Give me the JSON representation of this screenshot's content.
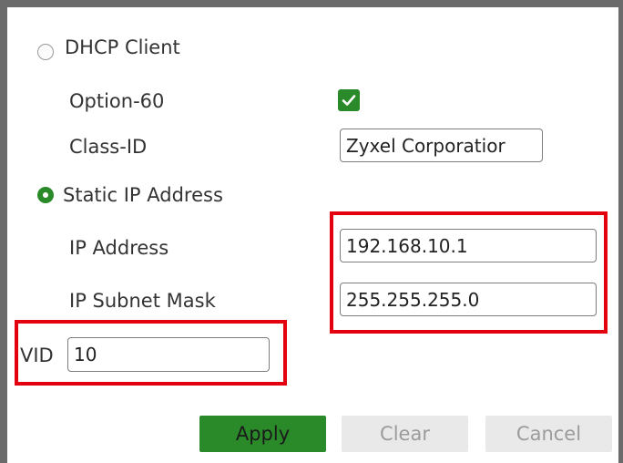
{
  "dhcp": {
    "label": "DHCP Client",
    "selected": false,
    "option60_label": "Option-60",
    "option60_checked": true,
    "class_id_label": "Class-ID",
    "class_id_value": "Zyxel Corporatior"
  },
  "static": {
    "label": "Static IP Address",
    "selected": true,
    "ip_label": "IP Address",
    "ip_value": "192.168.10.1",
    "mask_label": "IP Subnet Mask",
    "mask_value": "255.255.255.0"
  },
  "vid": {
    "label": "VID",
    "value": "10"
  },
  "buttons": {
    "apply": "Apply",
    "clear": "Clear",
    "cancel": "Cancel"
  },
  "colors": {
    "accent_green": "#2a8a2a",
    "highlight_red": "#e3000f",
    "panel_border": "#6b6b6b"
  },
  "icons": {
    "checkbox": "check-icon"
  }
}
